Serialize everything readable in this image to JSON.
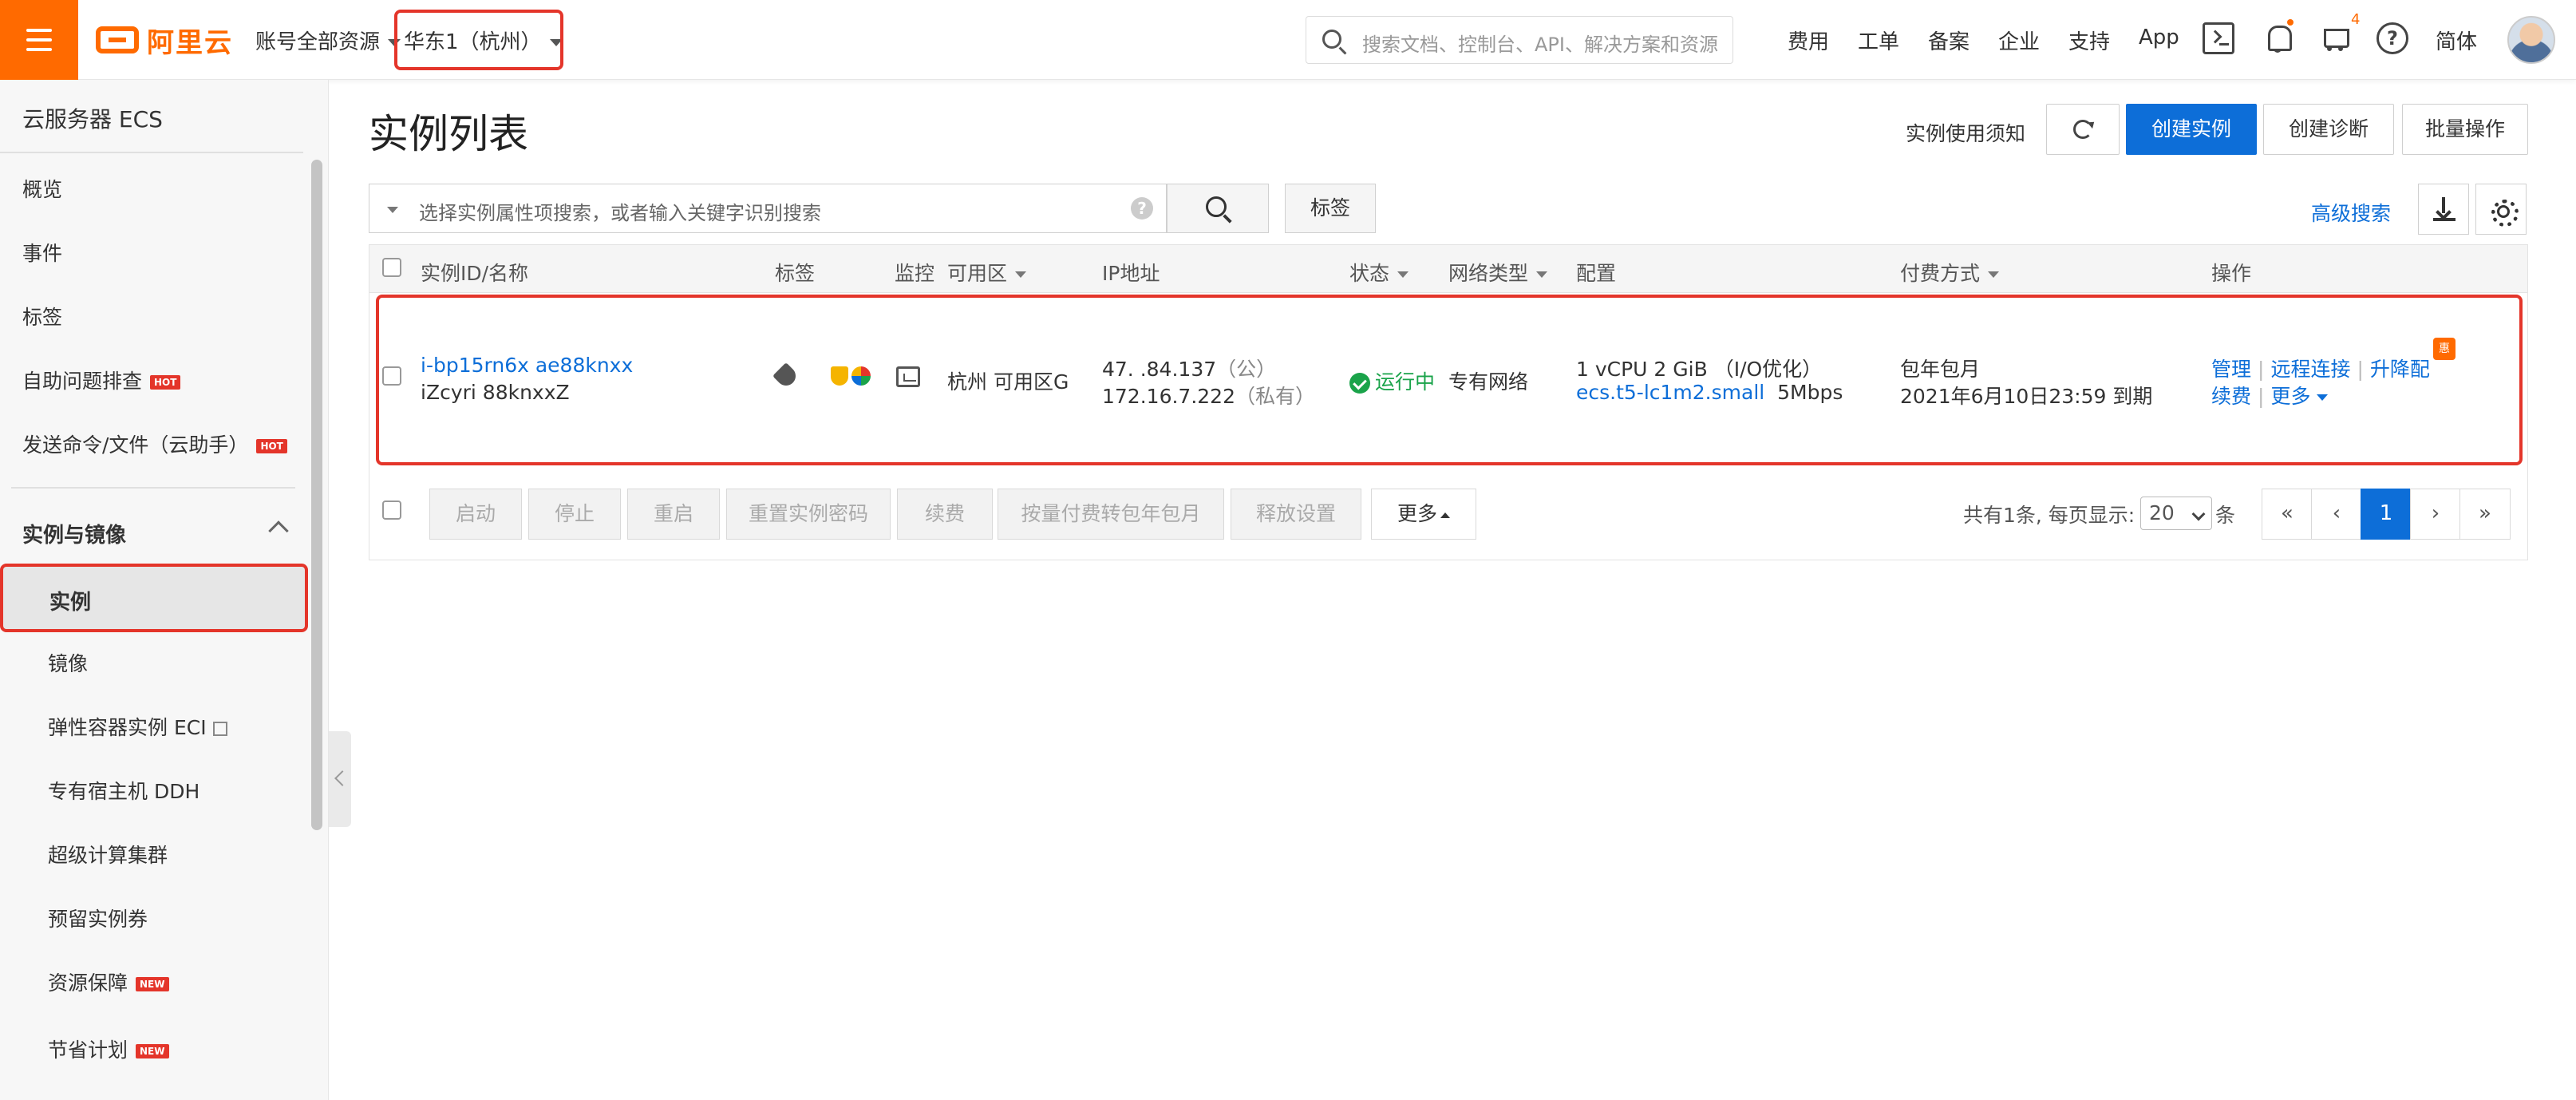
{
  "topbar": {
    "logo_text": "阿里云",
    "account_scope": "账号全部资源",
    "region": "华东1（杭州）",
    "search_placeholder": "搜索文档、控制台、API、解决方案和资源",
    "nav": [
      "费用",
      "工单",
      "备案",
      "企业",
      "支持",
      "App"
    ],
    "cart_count": "4",
    "language": "简体",
    "accent_color": "#ff6a00"
  },
  "sidebar": {
    "title": "云服务器 ECS",
    "items": [
      {
        "label": "概览"
      },
      {
        "label": "事件"
      },
      {
        "label": "标签"
      },
      {
        "label": "自助问题排查",
        "badge": "HOT"
      },
      {
        "label": "发送命令/文件（云助手）",
        "badge": "HOT"
      }
    ],
    "group_title": "实例与镜像",
    "sub_items": [
      {
        "label": "实例",
        "active": true
      },
      {
        "label": "镜像"
      },
      {
        "label": "弹性容器实例 ECI",
        "external": true
      },
      {
        "label": "专有宿主机 DDH"
      },
      {
        "label": "超级计算集群"
      },
      {
        "label": "预留实例券"
      },
      {
        "label": "资源保障",
        "badge": "NEW"
      },
      {
        "label": "节省计划",
        "badge": "NEW"
      }
    ]
  },
  "main": {
    "title": "实例列表",
    "notice_link": "实例使用须知",
    "buttons": {
      "create_instance": "创建实例",
      "create_diagnosis": "创建诊断",
      "batch_ops": "批量操作"
    },
    "filter_placeholder": "选择实例属性项搜索，或者输入关键字识别搜索",
    "tag_button": "标签",
    "advanced_search": "高级搜索",
    "columns": [
      "实例ID/名称",
      "标签",
      "监控",
      "可用区",
      "IP地址",
      "状态",
      "网络类型",
      "配置",
      "付费方式",
      "操作"
    ],
    "row": {
      "instance_id": "i-bp15rn6x   ae88knxx",
      "instance_name": "iZcyri   88knxxZ",
      "zone": "杭州 可用区G",
      "public_ip": "47.  .84.137",
      "public_suffix": "（公）",
      "private_ip": "172.16.7.222",
      "private_suffix": "（私有）",
      "status": "运行中",
      "network": "专有网络",
      "config_line1": "1 vCPU 2 GiB （I/O优化）",
      "instance_type": "ecs.t5-lc1m2.small",
      "bandwidth": "5Mbps",
      "billing": "包年包月",
      "expiry": "2021年6月10日23:59 到期",
      "actions": [
        "管理",
        "远程连接",
        "升降配",
        "续费",
        "更多"
      ],
      "promo_badge": "惠"
    },
    "footer_buttons": [
      "启动",
      "停止",
      "重启",
      "重置实例密码",
      "续费",
      "按量付费转包年包月",
      "释放设置"
    ],
    "more_button": "更多",
    "pagination": {
      "total_text": "共有1条, 每页显示:",
      "page_size": "20",
      "unit": "条",
      "buttons": [
        "«",
        "‹",
        "1",
        "›",
        "»"
      ]
    }
  }
}
